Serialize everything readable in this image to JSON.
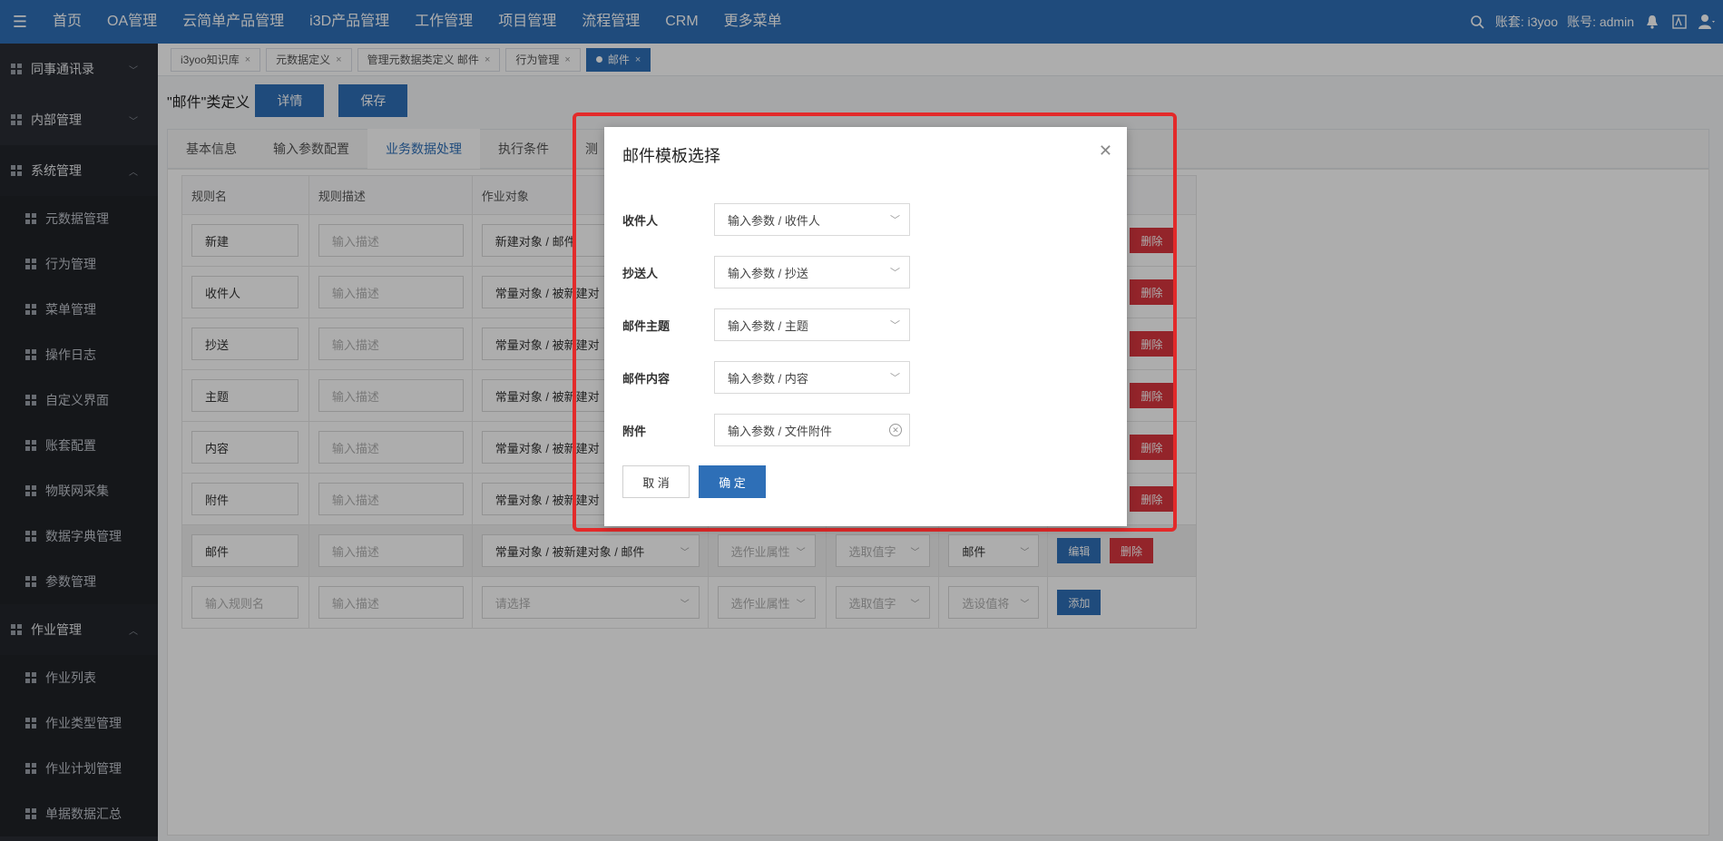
{
  "topbar": {
    "nav": [
      "首页",
      "OA管理",
      "云简单产品管理",
      "i3D产品管理",
      "工作管理",
      "项目管理",
      "流程管理",
      "CRM",
      "更多菜单"
    ],
    "account_label": "账套: i3yoo",
    "user_label": "账号: admin"
  },
  "sidebar": {
    "groups_top": [
      "同事通讯录",
      "内部管理"
    ],
    "system_group": "系统管理",
    "system_items": [
      "元数据管理",
      "行为管理",
      "菜单管理",
      "操作日志",
      "自定义界面",
      "账套配置",
      "物联网采集",
      "数据字典管理",
      "参数管理"
    ],
    "job_group": "作业管理",
    "job_items": [
      "作业列表",
      "作业类型管理",
      "作业计划管理",
      "单据数据汇总"
    ]
  },
  "page_tabs": [
    {
      "label": "i3yoo知识库"
    },
    {
      "label": "元数据定义"
    },
    {
      "label": "管理元数据类定义 邮件"
    },
    {
      "label": "行为管理"
    },
    {
      "label": "邮件"
    }
  ],
  "title": {
    "text": "\"邮件\"类定义",
    "detail_btn": "详情",
    "save_btn": "保存"
  },
  "sub_tabs": [
    "基本信息",
    "输入参数配置",
    "业务数据处理",
    "执行条件",
    "测"
  ],
  "table": {
    "headers": [
      "规则名",
      "规则描述",
      "作业对象"
    ],
    "desc_placeholder": "输入描述",
    "rows": [
      {
        "name": "新建",
        "target": "新建对象 / 邮件"
      },
      {
        "name": "收件人",
        "target": "常量对象 / 被新建对"
      },
      {
        "name": "抄送",
        "target": "常量对象 / 被新建对"
      },
      {
        "name": "主题",
        "target": "常量对象 / 被新建对"
      },
      {
        "name": "内容",
        "target": "常量对象 / 被新建对"
      },
      {
        "name": "附件",
        "target": "常量对象 / 被新建对"
      }
    ],
    "selected_row": {
      "name": "邮件",
      "target": "常量对象 / 被新建对象 / 邮件",
      "attr": "选作业属性",
      "value": "选取值字",
      "type": "邮件"
    },
    "new_row": {
      "name_placeholder": "输入规则名",
      "target_placeholder": "请选择",
      "attr": "选作业属性",
      "value": "选取值字",
      "type": "选设值将"
    },
    "edit_label": "编辑",
    "delete_label": "删除",
    "add_label": "添加"
  },
  "dialog": {
    "title": "邮件模板选择",
    "fields": [
      {
        "label": "收件人",
        "value": "输入参数 / 收件人"
      },
      {
        "label": "抄送人",
        "value": "输入参数 / 抄送"
      },
      {
        "label": "邮件主题",
        "value": "输入参数 / 主题"
      },
      {
        "label": "邮件内容",
        "value": "输入参数 / 内容"
      },
      {
        "label": "附件",
        "value": "输入参数 / 文件附件"
      }
    ],
    "cancel": "取 消",
    "ok": "确 定"
  },
  "colors": {
    "brand": "#2e6fb7",
    "danger": "#d9363e",
    "highlight_frame": "#e32a2a",
    "sidebar": "#2a2d34"
  }
}
